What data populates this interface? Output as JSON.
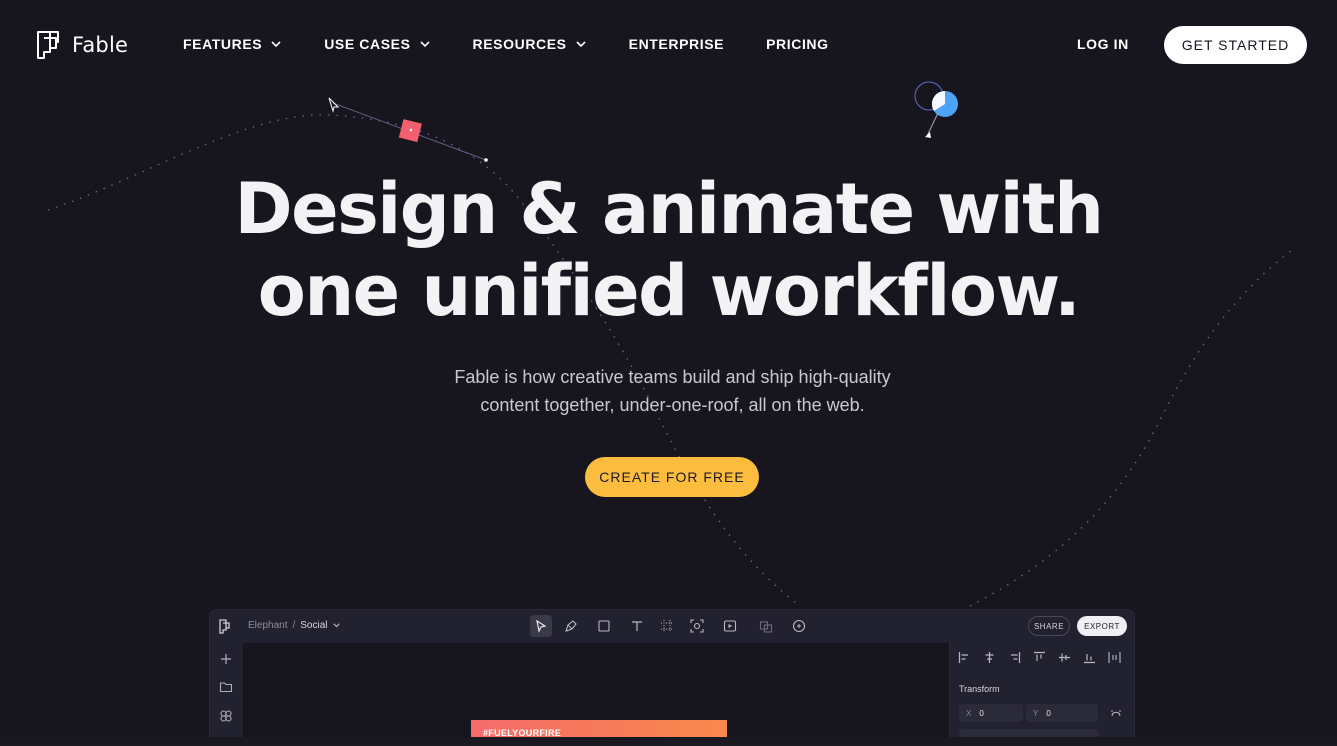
{
  "brand": {
    "name": "Fable"
  },
  "nav": {
    "items": [
      {
        "label": "FEATURES",
        "has_dropdown": true
      },
      {
        "label": "USE CASES",
        "has_dropdown": true
      },
      {
        "label": "RESOURCES",
        "has_dropdown": true
      },
      {
        "label": "ENTERPRISE",
        "has_dropdown": false
      },
      {
        "label": "PRICING",
        "has_dropdown": false
      }
    ],
    "login_label": "LOG IN",
    "cta_label": "GET STARTED"
  },
  "hero": {
    "title_line1": "Design & animate with",
    "title_line2": "one unified workflow.",
    "subtitle_line1": "Fable is how creative teams build and ship high-quality",
    "subtitle_line2": "content together, under-one-roof, all on the web.",
    "cta_label": "CREATE FOR FREE"
  },
  "app_preview": {
    "breadcrumb": {
      "project": "Elephant",
      "separator": "/",
      "file": "Social"
    },
    "share_label": "SHARE",
    "export_label": "EXPORT",
    "tools": [
      "select-icon",
      "pen-icon",
      "rectangle-icon",
      "text-icon",
      "grid-icon",
      "frame-icon",
      "media-icon",
      "shapes-icon",
      "comment-icon"
    ],
    "rail_icons": [
      "plus-icon",
      "folder-icon",
      "component-icon"
    ],
    "panel": {
      "transform_label": "Transform",
      "x_key": "X",
      "x_value": "0",
      "y_key": "Y",
      "y_value": "0"
    },
    "artboard_text": "#FUELYOURFIRE"
  },
  "colors": {
    "background": "#17161f",
    "accent_yellow": "#fcbd3f",
    "accent_pink": "#f25f6e",
    "accent_blue": "#4da3f5"
  }
}
